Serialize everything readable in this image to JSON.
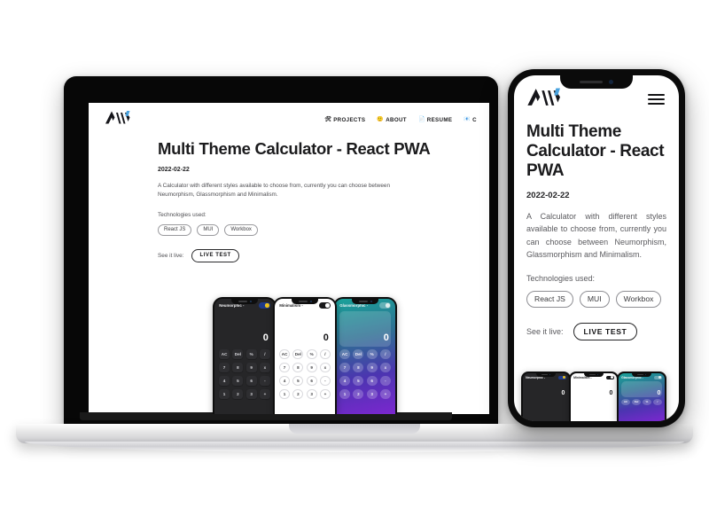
{
  "colors": {
    "page_background": "#ffffff",
    "laptop_bezel": "#070707",
    "laptop_base": "#d6d6d8",
    "phone_frame": "#0b0b0b",
    "logo_accent": "#4aa3df",
    "text_primary": "#1b1b1d",
    "text_muted": "#5a5a5e",
    "neumorphic_bg": "#262628",
    "minimalism_bg": "#ffffff",
    "glassmorphic_gradient_start": "#1aa39a",
    "glassmorphic_gradient_end": "#7b27cf"
  },
  "devices": {
    "laptop_label": "laptop-mockup",
    "phone_label": "iphone-mockup"
  },
  "site": {
    "logo_alt": "AW",
    "nav": [
      {
        "icon": "🛠",
        "label": "PROJECTS"
      },
      {
        "icon": "🙂",
        "label": "ABOUT"
      },
      {
        "icon": "📄",
        "label": "RESUME"
      },
      {
        "icon": "📧",
        "label": "C"
      }
    ],
    "menu_icon": "hamburger-menu"
  },
  "article": {
    "title": "Multi Theme Calculator - React PWA",
    "date": "2022-02-22",
    "description": "A Calculator with different styles available to choose from, currently you can choose between Neumorphism, Glassmorphism and Minimalism.",
    "technologies_label": "Technologies used:",
    "technologies": [
      "React JS",
      "MUI",
      "Workbox"
    ],
    "live_label": "See it live:",
    "live_button": "LIVE TEST"
  },
  "calculators": [
    {
      "theme": "Neumorphic",
      "title": "Neumorphic -",
      "display": "0",
      "toggle_state": "on",
      "keys": [
        "AC",
        "Del",
        "%",
        "/",
        "7",
        "8",
        "9",
        "x",
        "4",
        "5",
        "6",
        "-",
        "1",
        "2",
        "3",
        "+"
      ]
    },
    {
      "theme": "Minimalism",
      "title": "Minimalism -",
      "display": "0",
      "toggle_state": "on",
      "keys": [
        "AC",
        "Del",
        "%",
        "/",
        "7",
        "8",
        "9",
        "x",
        "4",
        "5",
        "6",
        "-",
        "1",
        "2",
        "3",
        "+"
      ]
    },
    {
      "theme": "Glassmorphic",
      "title": "Glassmorphic -",
      "display": "0",
      "toggle_state": "off",
      "keys": [
        "AC",
        "Del",
        "%",
        "/",
        "7",
        "8",
        "9",
        "x",
        "4",
        "5",
        "6",
        "-",
        "1",
        "2",
        "3",
        "+"
      ]
    }
  ]
}
